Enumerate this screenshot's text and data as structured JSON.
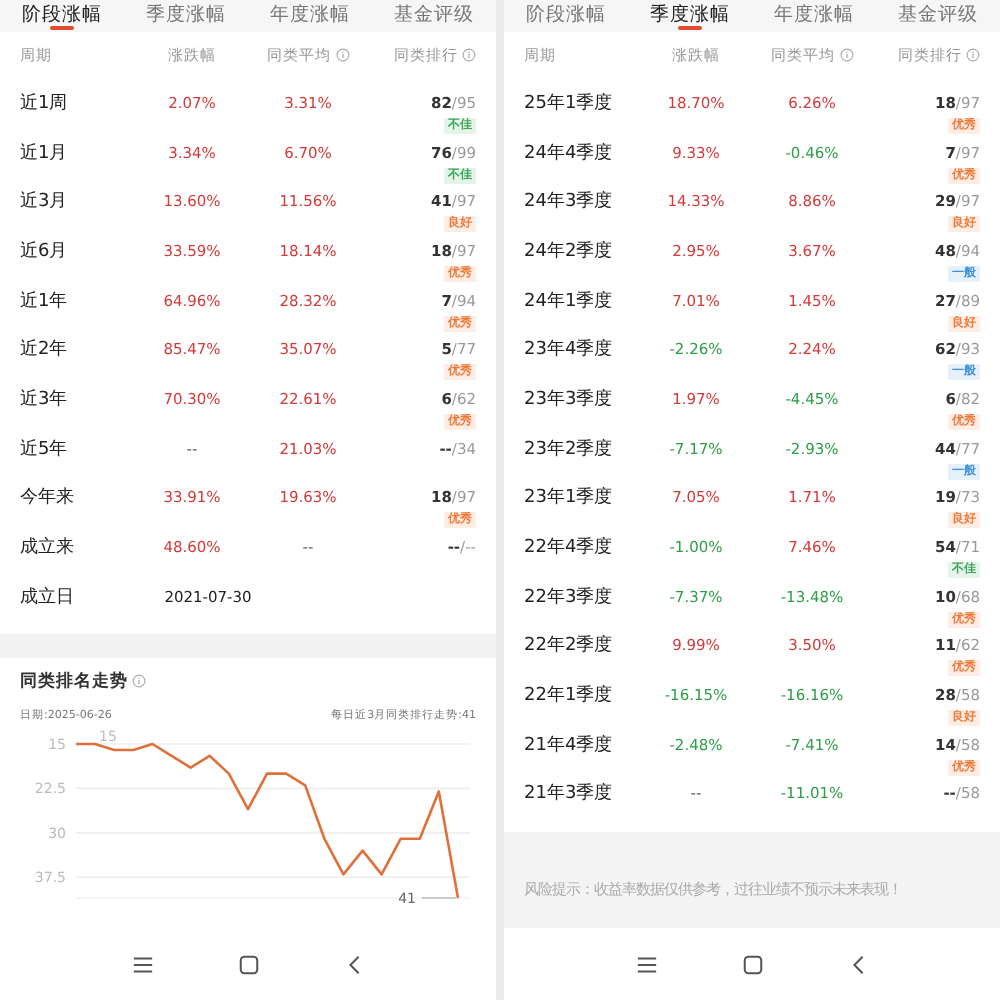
{
  "panels": [
    {
      "tabs": [
        {
          "label": "阶段涨幅",
          "selected": true
        },
        {
          "label": "季度涨幅",
          "selected": false
        },
        {
          "label": "年度涨幅",
          "selected": false
        },
        {
          "label": "基金评级",
          "selected": false
        }
      ],
      "table": {
        "columns": [
          "周期",
          "涨跌幅",
          "同类平均",
          "同类排行"
        ],
        "rows": [
          {
            "period": "近1周",
            "change": {
              "text": "2.07%",
              "color": "#d43a3a"
            },
            "average": {
              "text": "3.31%",
              "color": "#d43a3a"
            },
            "rank": "82",
            "total": "/95",
            "badge": {
              "text": "不佳",
              "color": "#3aa657"
            }
          },
          {
            "period": "近1月",
            "change": {
              "text": "3.34%",
              "color": "#d43a3a"
            },
            "average": {
              "text": "6.70%",
              "color": "#d43a3a"
            },
            "rank": "76",
            "total": "/99",
            "badge": {
              "text": "不佳",
              "color": "#3aa657"
            }
          },
          {
            "period": "近3月",
            "change": {
              "text": "13.60%",
              "color": "#d43a3a"
            },
            "average": {
              "text": "11.56%",
              "color": "#d43a3a"
            },
            "rank": "41",
            "total": "/97",
            "badge": {
              "text": "良好",
              "color": "#ee7b3a"
            }
          },
          {
            "period": "近6月",
            "change": {
              "text": "33.59%",
              "color": "#d43a3a"
            },
            "average": {
              "text": "18.14%",
              "color": "#d43a3a"
            },
            "rank": "18",
            "total": "/97",
            "badge": {
              "text": "优秀",
              "color": "#ee7b3a"
            }
          },
          {
            "period": "近1年",
            "change": {
              "text": "64.96%",
              "color": "#d43a3a"
            },
            "average": {
              "text": "28.32%",
              "color": "#d43a3a"
            },
            "rank": "7",
            "total": "/94",
            "badge": {
              "text": "优秀",
              "color": "#ee7b3a"
            }
          },
          {
            "period": "近2年",
            "change": {
              "text": "85.47%",
              "color": "#d43a3a"
            },
            "average": {
              "text": "35.07%",
              "color": "#d43a3a"
            },
            "rank": "5",
            "total": "/77",
            "badge": {
              "text": "优秀",
              "color": "#ee7b3a"
            }
          },
          {
            "period": "近3年",
            "change": {
              "text": "70.30%",
              "color": "#d43a3a"
            },
            "average": {
              "text": "22.61%",
              "color": "#d43a3a"
            },
            "rank": "6",
            "total": "/62",
            "badge": {
              "text": "优秀",
              "color": "#ee7b3a"
            }
          },
          {
            "period": "近5年",
            "change": {
              "text": "--"
            },
            "average": {
              "text": "21.03%",
              "color": "#d43a3a"
            },
            "rank": "--",
            "total": "/34"
          },
          {
            "period": "今年来",
            "change": {
              "text": "33.91%",
              "color": "#d43a3a"
            },
            "average": {
              "text": "19.63%",
              "color": "#d43a3a"
            },
            "rank": "18",
            "total": "/97",
            "badge": {
              "text": "优秀",
              "color": "#ee7b3a"
            }
          },
          {
            "period": "成立来",
            "change": {
              "text": "48.60%",
              "color": "#d43a3a"
            },
            "average": {
              "text": "--"
            },
            "rank": "--",
            "total": "/--"
          },
          {
            "period": "成立日",
            "date": "2021-07-30"
          }
        ]
      },
      "rank_trend": {
        "title": "同类排名走势",
        "date": "日期:2025-06-26",
        "summary": "每日近3月同类排行走势:41",
        "chart_data": {
          "type": "line",
          "series": [
            {
              "color": "#e0703a",
              "values": [
                15,
                15,
                16,
                16,
                15,
                17,
                19,
                17,
                20,
                26,
                20,
                20,
                22,
                31,
                37,
                33,
                37,
                31,
                31,
                23,
                41
              ]
            }
          ],
          "yticks": [
            15,
            22.5,
            30,
            37.5
          ],
          "ylim": [
            41,
            15
          ],
          "grid": true,
          "value_labels": [
            null,
            "15",
            null,
            null,
            null,
            null,
            null,
            null,
            null,
            null,
            null,
            null,
            null,
            null,
            null,
            null,
            null,
            null,
            null,
            null,
            "41"
          ]
        }
      }
    },
    {
      "tabs": [
        {
          "label": "阶段涨幅",
          "selected": false
        },
        {
          "label": "季度涨幅",
          "selected": true
        },
        {
          "label": "年度涨幅",
          "selected": false
        },
        {
          "label": "基金评级",
          "selected": false
        }
      ],
      "table": {
        "columns": [
          "周期",
          "涨跌幅",
          "同类平均",
          "同类排行"
        ],
        "rows": [
          {
            "period": "25年1季度",
            "change": {
              "text": "18.70%",
              "color": "#d43a3a"
            },
            "average": {
              "text": "6.26%",
              "color": "#d43a3a"
            },
            "rank": "18",
            "total": "/97",
            "badge": {
              "text": "优秀",
              "color": "#ee7b3a"
            }
          },
          {
            "period": "24年4季度",
            "change": {
              "text": "9.33%",
              "color": "#d43a3a"
            },
            "average": {
              "text": "-0.46%",
              "color": "#2f9e48"
            },
            "rank": "7",
            "total": "/97",
            "badge": {
              "text": "优秀",
              "color": "#ee7b3a"
            }
          },
          {
            "period": "24年3季度",
            "change": {
              "text": "14.33%",
              "color": "#d43a3a"
            },
            "average": {
              "text": "8.86%",
              "color": "#d43a3a"
            },
            "rank": "29",
            "total": "/97",
            "badge": {
              "text": "良好",
              "color": "#ee7b3a"
            }
          },
          {
            "period": "24年2季度",
            "change": {
              "text": "2.95%",
              "color": "#d43a3a"
            },
            "average": {
              "text": "3.67%",
              "color": "#d43a3a"
            },
            "rank": "48",
            "total": "/94",
            "badge": {
              "text": "一般",
              "color": "#3d8fd6"
            }
          },
          {
            "period": "24年1季度",
            "change": {
              "text": "7.01%",
              "color": "#d43a3a"
            },
            "average": {
              "text": "1.45%",
              "color": "#d43a3a"
            },
            "rank": "27",
            "total": "/89",
            "badge": {
              "text": "良好",
              "color": "#ee7b3a"
            }
          },
          {
            "period": "23年4季度",
            "change": {
              "text": "-2.26%",
              "color": "#2f9e48"
            },
            "average": {
              "text": "2.24%",
              "color": "#d43a3a"
            },
            "rank": "62",
            "total": "/93",
            "badge": {
              "text": "一般",
              "color": "#3d8fd6"
            }
          },
          {
            "period": "23年3季度",
            "change": {
              "text": "1.97%",
              "color": "#d43a3a"
            },
            "average": {
              "text": "-4.45%",
              "color": "#2f9e48"
            },
            "rank": "6",
            "total": "/82",
            "badge": {
              "text": "优秀",
              "color": "#ee7b3a"
            }
          },
          {
            "period": "23年2季度",
            "change": {
              "text": "-7.17%",
              "color": "#2f9e48"
            },
            "average": {
              "text": "-2.93%",
              "color": "#2f9e48"
            },
            "rank": "44",
            "total": "/77",
            "badge": {
              "text": "一般",
              "color": "#3d8fd6"
            }
          },
          {
            "period": "23年1季度",
            "change": {
              "text": "7.05%",
              "color": "#d43a3a"
            },
            "average": {
              "text": "1.71%",
              "color": "#d43a3a"
            },
            "rank": "19",
            "total": "/73",
            "badge": {
              "text": "良好",
              "color": "#ee7b3a"
            }
          },
          {
            "period": "22年4季度",
            "change": {
              "text": "-1.00%",
              "color": "#2f9e48"
            },
            "average": {
              "text": "7.46%",
              "color": "#d43a3a"
            },
            "rank": "54",
            "total": "/71",
            "badge": {
              "text": "不佳",
              "color": "#3aa657"
            }
          },
          {
            "period": "22年3季度",
            "change": {
              "text": "-7.37%",
              "color": "#2f9e48"
            },
            "average": {
              "text": "-13.48%",
              "color": "#2f9e48"
            },
            "rank": "10",
            "total": "/68",
            "badge": {
              "text": "优秀",
              "color": "#ee7b3a"
            }
          },
          {
            "period": "22年2季度",
            "change": {
              "text": "9.99%",
              "color": "#d43a3a"
            },
            "average": {
              "text": "3.50%",
              "color": "#d43a3a"
            },
            "rank": "11",
            "total": "/62",
            "badge": {
              "text": "优秀",
              "color": "#ee7b3a"
            }
          },
          {
            "period": "22年1季度",
            "change": {
              "text": "-16.15%",
              "color": "#2f9e48"
            },
            "average": {
              "text": "-16.16%",
              "color": "#2f9e48"
            },
            "rank": "28",
            "total": "/58",
            "badge": {
              "text": "良好",
              "color": "#ee7b3a"
            }
          },
          {
            "period": "21年4季度",
            "change": {
              "text": "-2.48%",
              "color": "#2f9e48"
            },
            "average": {
              "text": "-7.41%",
              "color": "#2f9e48"
            },
            "rank": "14",
            "total": "/58",
            "badge": {
              "text": "优秀",
              "color": "#ee7b3a"
            }
          },
          {
            "period": "21年3季度",
            "change": {
              "text": "--"
            },
            "average": {
              "text": "-11.01%",
              "color": "#2f9e48"
            },
            "rank": "--",
            "total": "/58"
          }
        ]
      },
      "risk_note": "风险提示：收益率数据仅供参考，过往业绩不预示未来表现！"
    }
  ]
}
